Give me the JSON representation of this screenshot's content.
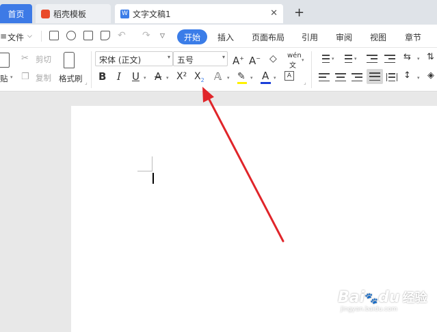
{
  "tabs": {
    "home": "首页",
    "templates": "稻壳模板",
    "document": "文字文稿1",
    "close_glyph": "✕",
    "new_glyph": "+"
  },
  "menu": {
    "file": "文件",
    "items": [
      "开始",
      "插入",
      "页面布局",
      "引用",
      "审阅",
      "视图",
      "章节"
    ]
  },
  "ribbon": {
    "paste": "贴",
    "cut": "剪切",
    "copy": "复制",
    "format_painter": "格式刷",
    "font_name": "宋体 (正文)",
    "font_size": "五号",
    "pinyin": "wén",
    "bold": "B",
    "italic": "I",
    "underline": "U",
    "strike": "A",
    "superscript": "X²",
    "subscript_x": "X",
    "subscript_2": "2",
    "font_color": "A"
  },
  "watermark": {
    "brand": "Bai",
    "brand2": "du",
    "cn": "经验",
    "url": "jingyan.baidu.com"
  },
  "colors": {
    "accent": "#3b7de8",
    "arrow": "#e0252a"
  }
}
